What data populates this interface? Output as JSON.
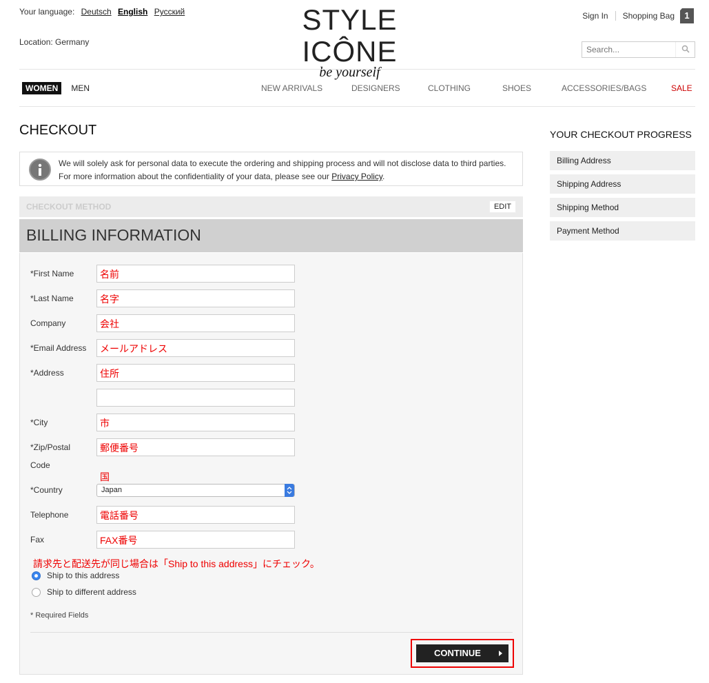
{
  "header": {
    "language_label": "Your language:",
    "languages": [
      {
        "label": "Deutsch",
        "active": false
      },
      {
        "label": "English",
        "active": true
      },
      {
        "label": "Русский",
        "active": false
      }
    ],
    "location": "Location: Germany",
    "logo_main": "STYLE ICÔNE",
    "logo_sub": "be yourself",
    "sign_in": "Sign In",
    "shopping_bag": "Shopping Bag",
    "bag_count": "1",
    "search_placeholder": "Search..."
  },
  "nav": {
    "women": "WOMEN",
    "men": "MEN",
    "items": [
      "NEW ARRIVALS",
      "DESIGNERS",
      "CLOTHING",
      "SHOES",
      "ACCESSORIES/BAGS",
      "SALE"
    ]
  },
  "main": {
    "title": "CHECKOUT",
    "info_line1": "We will solely ask for personal data to execute the ordering and shipping process and will not disclose data to third parties.",
    "info_line2_prefix": "For more information about the confidentiality of your data, please see our",
    "privacy_link": "Privacy Policy",
    "info_line2_suffix": ".",
    "checkout_method": "CHECKOUT METHOD",
    "edit": "EDIT",
    "billing_title": "BILLING INFORMATION",
    "fields": {
      "first_name": {
        "label": "*First Name",
        "value": "名前"
      },
      "last_name": {
        "label": "*Last Name",
        "value": "名字"
      },
      "company": {
        "label": "Company",
        "value": "会社"
      },
      "email": {
        "label": "*Email Address",
        "value": "メールアドレス"
      },
      "address": {
        "label": "*Address",
        "value": "住所",
        "value2": ""
      },
      "city": {
        "label": "*City",
        "value": "市"
      },
      "zip_line1": "*Zip/Postal",
      "zip_line2": "Code",
      "zip_value": "郵便番号",
      "country_note": "国",
      "country": {
        "label": "*Country",
        "value": "Japan"
      },
      "telephone": {
        "label": "Telephone",
        "value": "電話番号"
      },
      "fax": {
        "label": "Fax",
        "value": "FAX番号"
      }
    },
    "same_address_note": "請求先と配送先が同じ場合は「Ship to this address」にチェック。",
    "ship_this": "Ship to this address",
    "ship_different": "Ship to different address",
    "required": "* Required Fields",
    "continue": "CONTINUE"
  },
  "sidebar": {
    "title": "YOUR CHECKOUT PROGRESS",
    "items": [
      "Billing Address",
      "Shipping Address",
      "Shipping Method",
      "Payment Method"
    ]
  },
  "colors": {
    "accent_red": "#e00000",
    "sale_red": "#cc0000",
    "radio_blue": "#3a86f0"
  }
}
